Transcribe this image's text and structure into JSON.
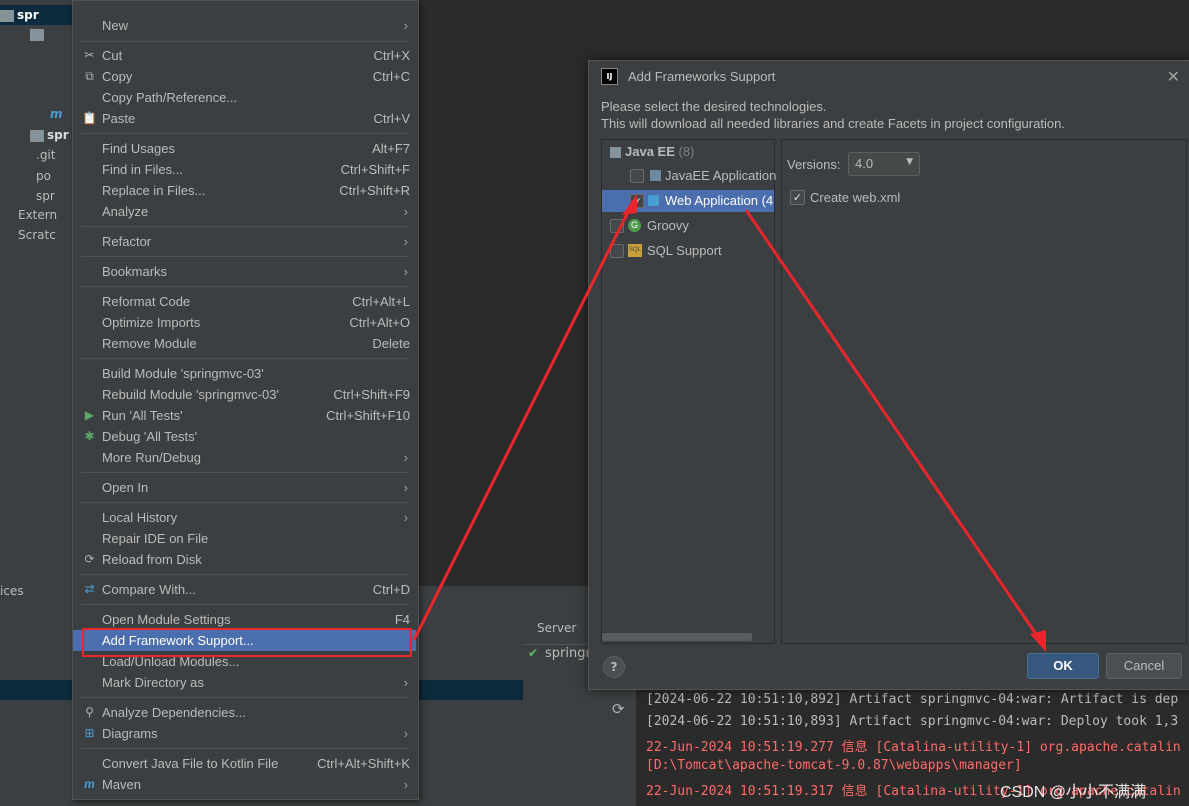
{
  "tree": {
    "rows": [
      "spr",
      "",
      "",
      "",
      "",
      "m",
      "spr",
      ".git",
      "po",
      "spr",
      "Extern",
      "Scratc"
    ],
    "services_label": "ices"
  },
  "menu": {
    "items": [
      {
        "label": "New",
        "arrow": true
      },
      {
        "label": "Cut",
        "shortcut": "Ctrl+X",
        "icon": "scissors-icon"
      },
      {
        "label": "Copy",
        "shortcut": "Ctrl+C",
        "icon": "copy-icon"
      },
      {
        "label": "Copy Path/Reference..."
      },
      {
        "label": "Paste",
        "shortcut": "Ctrl+V",
        "icon": "paste-icon"
      },
      {
        "label": "Find Usages",
        "shortcut": "Alt+F7"
      },
      {
        "label": "Find in Files...",
        "shortcut": "Ctrl+Shift+F"
      },
      {
        "label": "Replace in Files...",
        "shortcut": "Ctrl+Shift+R"
      },
      {
        "label": "Analyze",
        "arrow": true
      },
      {
        "label": "Refactor",
        "arrow": true
      },
      {
        "label": "Bookmarks",
        "arrow": true
      },
      {
        "label": "Reformat Code",
        "shortcut": "Ctrl+Alt+L"
      },
      {
        "label": "Optimize Imports",
        "shortcut": "Ctrl+Alt+O"
      },
      {
        "label": "Remove Module",
        "shortcut": "Delete"
      },
      {
        "label": "Build Module 'springmvc-03'"
      },
      {
        "label": "Rebuild Module 'springmvc-03'",
        "shortcut": "Ctrl+Shift+F9"
      },
      {
        "label": "Run 'All Tests'",
        "shortcut": "Ctrl+Shift+F10",
        "icon": "run-icon"
      },
      {
        "label": "Debug 'All Tests'",
        "icon": "debug-icon"
      },
      {
        "label": "More Run/Debug",
        "arrow": true
      },
      {
        "label": "Open In",
        "arrow": true
      },
      {
        "label": "Local History",
        "arrow": true
      },
      {
        "label": "Repair IDE on File"
      },
      {
        "label": "Reload from Disk",
        "icon": "reload-icon"
      },
      {
        "label": "Compare With...",
        "shortcut": "Ctrl+D",
        "icon": "compare-icon"
      },
      {
        "label": "Open Module Settings",
        "shortcut": "F4"
      },
      {
        "label": "Add Framework Support..."
      },
      {
        "label": "Load/Unload Modules..."
      },
      {
        "label": "Mark Directory as",
        "arrow": true
      },
      {
        "label": "Analyze Dependencies...",
        "icon": "analyze-icon"
      },
      {
        "label": "Diagrams",
        "arrow": true,
        "icon": "diagram-icon"
      },
      {
        "label": "Convert Java File to Kotlin File",
        "shortcut": "Ctrl+Alt+Shift+K"
      },
      {
        "label": "Maven",
        "arrow": true,
        "icon": "maven-icon"
      }
    ]
  },
  "dialog": {
    "title": "Add Frameworks Support",
    "desc1": "Please select the desired technologies.",
    "desc2": "This will download all needed libraries and create Facets in project configuration.",
    "group": "Java EE",
    "group_count": "(8)",
    "items": [
      "JavaEE Application",
      "Web Application (4",
      "Groovy",
      "SQL Support"
    ],
    "versions_label": "Versions:",
    "version_value": "4.0",
    "create_webxml": "Create web.xml",
    "ok": "OK",
    "cancel": "Cancel",
    "help": "?"
  },
  "server": {
    "tab": "Server",
    "item": "springn"
  },
  "log": {
    "lines": [
      "[2024-06-22 10:51:10,892] Artifact springmvc-04:war: Artifact is dep",
      "[2024-06-22 10:51:10,893] Artifact springmvc-04:war: Deploy took 1,3",
      "22-Jun-2024 10:51:19.277 信息 [Catalina-utility-1] org.apache.catalin",
      " [D:\\Tomcat\\apache-tomcat-9.0.87\\webapps\\manager]",
      "22-Jun-2024 10:51:19.317 信息 [Catalina-utility-1] org.apache.catalin"
    ]
  },
  "watermark": "CSDN @小小不满满",
  "colors": {
    "highlight": "#4b6eaf",
    "arrow": "#e8262b",
    "ok_button": "#365880"
  }
}
